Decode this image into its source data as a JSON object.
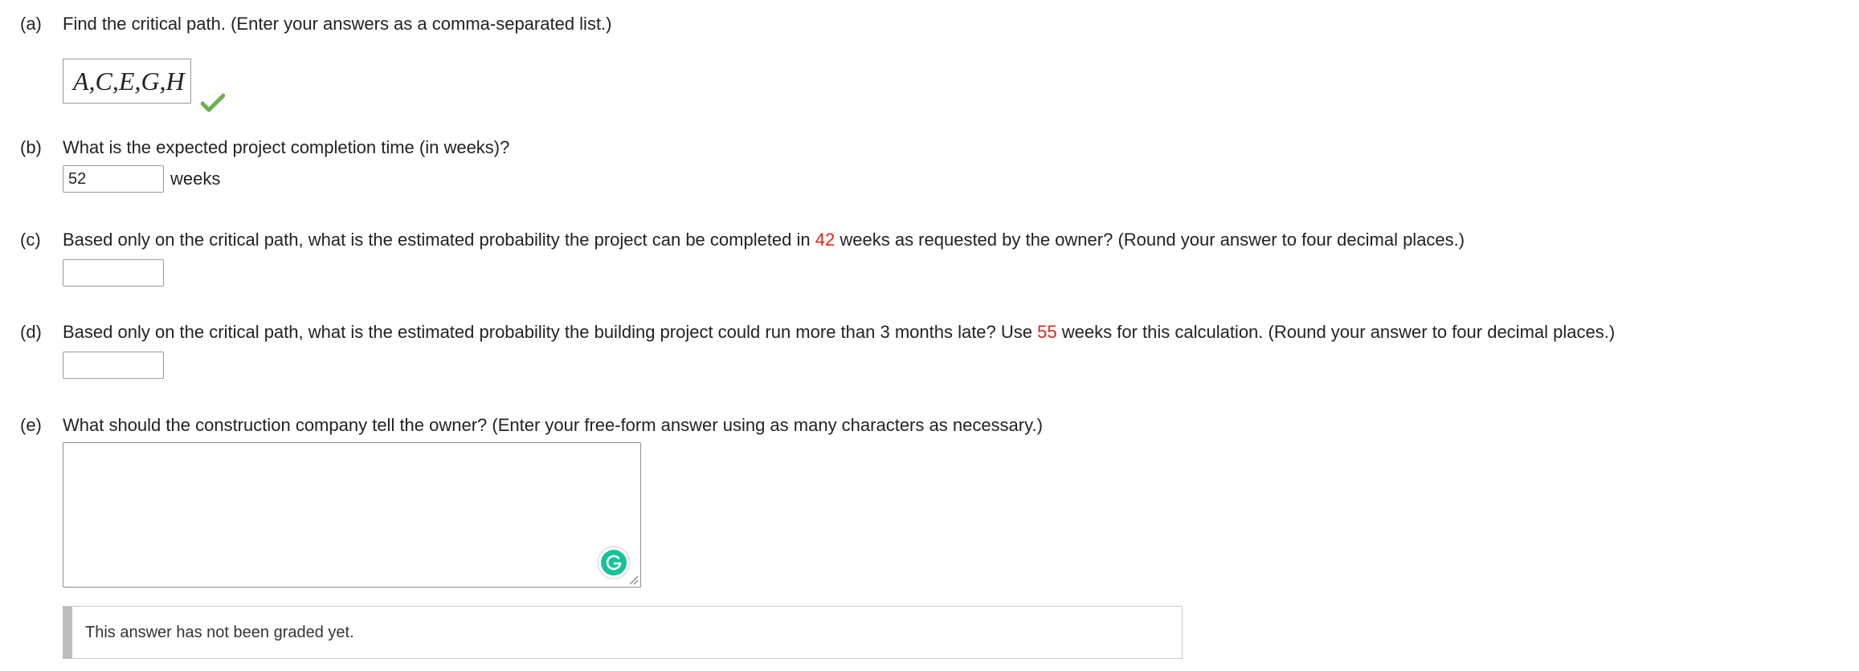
{
  "parts": {
    "a": {
      "letter": "(a)",
      "question": "Find the critical path. (Enter your answers as a comma-separated list.)",
      "answer": "A,C,E,G,H",
      "status": "correct"
    },
    "b": {
      "letter": "(b)",
      "question": "What is the expected project completion time (in weeks)?",
      "value": "52",
      "unit": "weeks"
    },
    "c": {
      "letter": "(c)",
      "question_pre": "Based only on the critical path, what is the estimated probability the project can be completed in ",
      "highlight": "42",
      "question_post": " weeks as requested by the owner? (Round your answer to four decimal places.)",
      "value": ""
    },
    "d": {
      "letter": "(d)",
      "question_pre": "Based only on the critical path, what is the estimated probability the building project could run more than 3 months late? Use ",
      "highlight": "55",
      "question_post": " weeks for this calculation. (Round your answer to four decimal places.)",
      "value": ""
    },
    "e": {
      "letter": "(e)",
      "question": "What should the construction company tell the owner? (Enter your free-form answer using as many characters as necessary.)",
      "value": ""
    }
  },
  "notice": {
    "text": "This answer has not been graded yet."
  },
  "colors": {
    "highlight": "#e2231a",
    "check": "#6ab04c",
    "grammarly": "#15c39a"
  }
}
